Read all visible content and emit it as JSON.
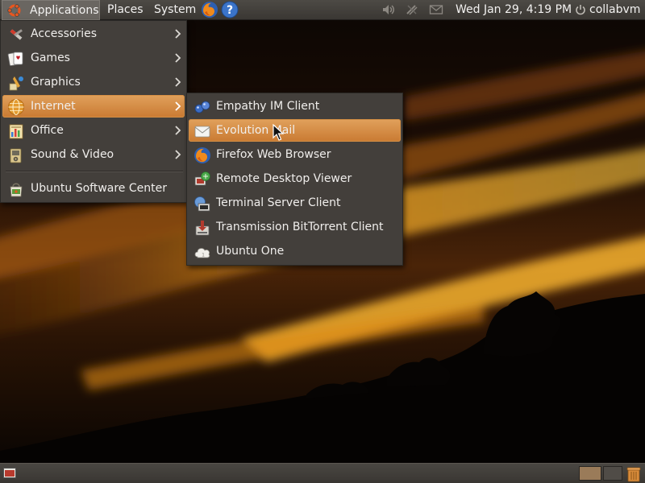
{
  "top_panel": {
    "menus": {
      "applications": "Applications",
      "places": "Places",
      "system": "System"
    },
    "launchers": [
      "firefox-icon",
      "help-icon"
    ],
    "tray": [
      "volume-icon",
      "network-icon",
      "mail-icon"
    ],
    "clock": "Wed Jan 29,  4:19 PM",
    "user": "collabvm"
  },
  "applications_menu": {
    "items": [
      {
        "label": "Accessories",
        "icon": "accessories-icon",
        "submenu": true
      },
      {
        "label": "Games",
        "icon": "games-icon",
        "submenu": true
      },
      {
        "label": "Graphics",
        "icon": "graphics-icon",
        "submenu": true
      },
      {
        "label": "Internet",
        "icon": "internet-globe-icon",
        "submenu": true,
        "highlighted": true
      },
      {
        "label": "Office",
        "icon": "office-icon",
        "submenu": true
      },
      {
        "label": "Sound & Video",
        "icon": "sound-video-icon",
        "submenu": true
      },
      {
        "label": "Ubuntu Software Center",
        "icon": "software-center-icon",
        "submenu": false
      }
    ]
  },
  "internet_menu": {
    "items": [
      {
        "label": "Empathy IM Client",
        "icon": "empathy-icon"
      },
      {
        "label": "Evolution Mail",
        "icon": "evolution-icon",
        "highlighted": true
      },
      {
        "label": "Firefox Web Browser",
        "icon": "firefox-icon"
      },
      {
        "label": "Remote Desktop Viewer",
        "icon": "remote-desktop-icon"
      },
      {
        "label": "Terminal Server Client",
        "icon": "terminal-server-icon"
      },
      {
        "label": "Transmission BitTorrent Client",
        "icon": "transmission-icon"
      },
      {
        "label": "Ubuntu One",
        "icon": "ubuntu-one-icon"
      }
    ]
  },
  "bottom_panel": {
    "left": [
      "show-desktop-icon"
    ],
    "right": [
      "workspace-switcher",
      "trash-icon"
    ]
  },
  "colors": {
    "panel": "#3f3c38",
    "menu_bg": "#433f3b",
    "highlight": "#d9904a",
    "text": "#f0eeec"
  }
}
